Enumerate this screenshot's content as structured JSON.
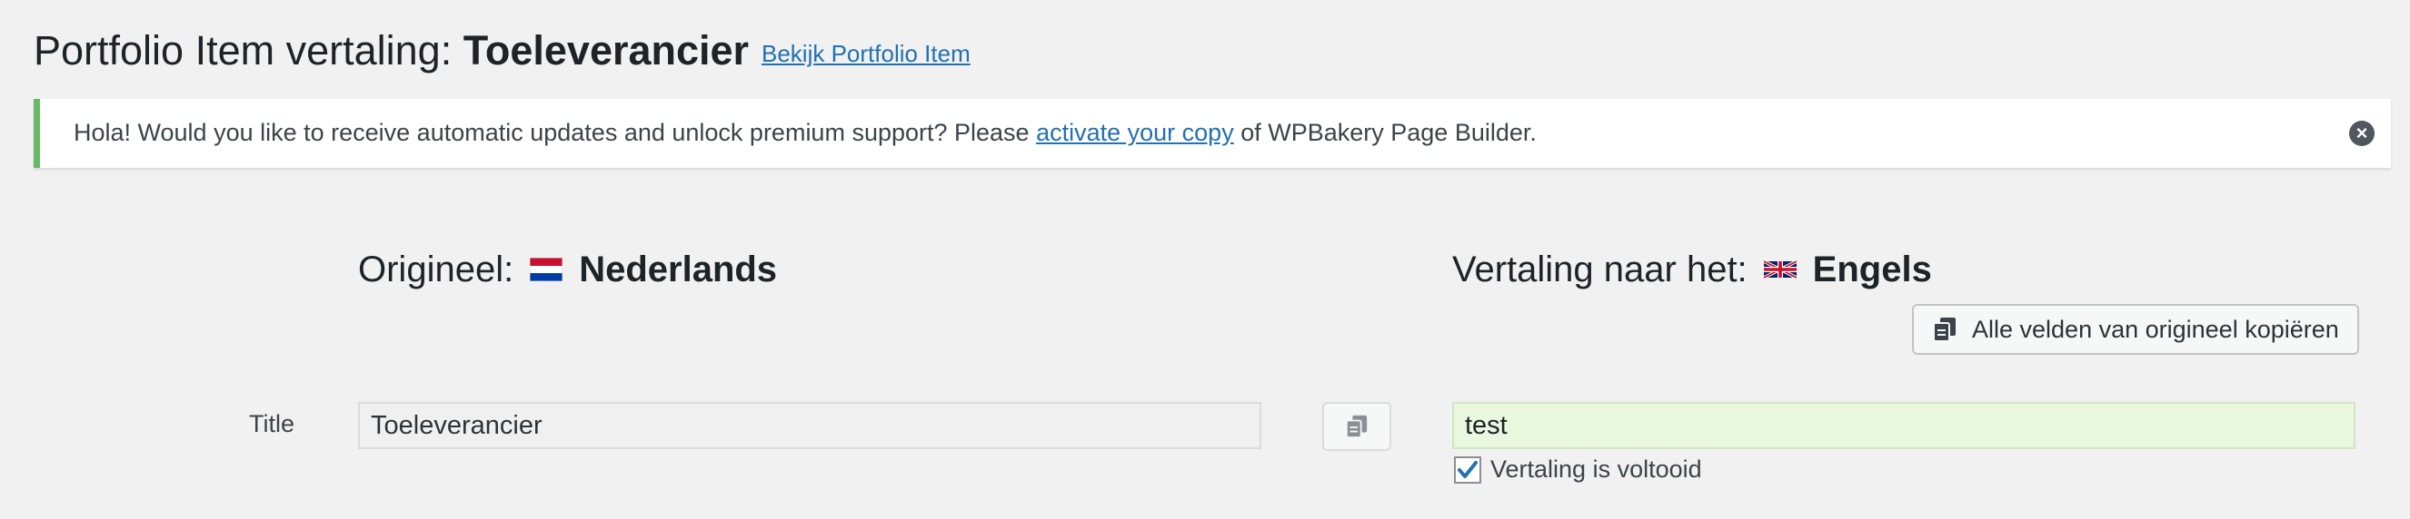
{
  "header": {
    "title_prefix": "Portfolio Item vertaling:",
    "title_item": "Toeleverancier",
    "view_link": "Bekijk Portfolio Item"
  },
  "notice": {
    "text_before": "Hola! Would you like to receive automatic updates and unlock premium support? Please",
    "link_text": "activate your copy",
    "text_after": "of WPBakery Page Builder.",
    "close_icon": "close-circle-icon",
    "accent_color": "#68b964"
  },
  "original": {
    "label": "Origineel:",
    "language": "Nederlands",
    "flag_icon": "flag-nl-icon"
  },
  "translation": {
    "label": "Vertaling naar het:",
    "language": "Engels",
    "flag_icon": "flag-gb-icon",
    "copy_all_label": "Alle velden van origineel kopiëren"
  },
  "fields": [
    {
      "label": "Title",
      "original_value": "Toeleverancier",
      "translated_value": "test",
      "complete_label": "Vertaling is voltooid",
      "complete_checked": true
    }
  ],
  "colors": {
    "link": "#2271b1",
    "translated_bg": "#e9f7df",
    "checkmark": "#2271b1"
  }
}
